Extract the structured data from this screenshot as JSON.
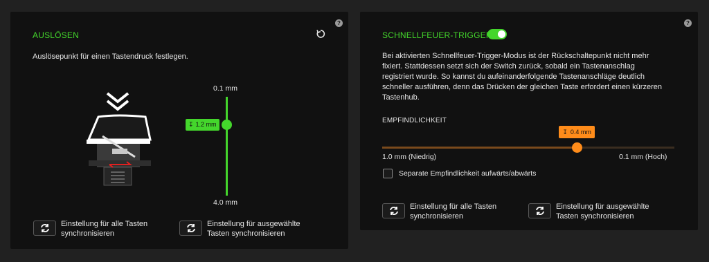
{
  "actuation": {
    "title": "AUSLÖSEN",
    "description": "Auslösepunkt für einen Tastendruck festlegen.",
    "slider": {
      "top_label": "0.1 mm",
      "bottom_label": "4.0 mm",
      "value_label": "1.2 mm",
      "min_mm": 0.1,
      "max_mm": 4.0,
      "value_mm": 1.2
    },
    "sync_all_lines": [
      "Einstellung für alle Tasten",
      "synchronisieren"
    ],
    "sync_selected_lines": [
      "Einstellung für ausgewählte",
      "Tasten synchronisieren"
    ]
  },
  "rapid_trigger": {
    "title": "SCHNELLFEUER-TRIGGER",
    "enabled": true,
    "description_lines": [
      "Bei aktivierten Schnellfeuer-Trigger-Modus ist der Rückschaltepunkt nicht mehr",
      "fixiert. Stattdessen setzt sich der Switch zurück, sobald ein Tastenanschlag",
      "registriert wurde. So kannst du aufeinanderfolgende Tastenanschläge deutlich",
      "schneller ausführen, denn das Drücken der gleichen Taste erfordert einen kürzeren",
      "Tastenhub."
    ],
    "sensitivity": {
      "label": "EMPFINDLICHKEIT",
      "value_label": "0.4 mm",
      "left_label": "1.0 mm (Niedrig)",
      "right_label": "0.1 mm (Hoch)",
      "min_mm": 1.0,
      "max_mm": 0.1,
      "value_mm": 0.4
    },
    "separate_label": "Separate Empfindlichkeit aufwärts/abwärts",
    "sync_all_lines": [
      "Einstellung für alle Tasten",
      "synchronisieren"
    ],
    "sync_selected_lines": [
      "Einstellung für ausgewählte",
      "Tasten synchronisieren"
    ]
  },
  "colors": {
    "accent": "#44d62c",
    "orange": "#ff8c1a",
    "panel": "#111111",
    "background": "#212121"
  },
  "icons": [
    "help-icon",
    "reset-icon",
    "sync-icon",
    "chevron-down-icon",
    "toggle-switch",
    "down-arrow-icon"
  ]
}
